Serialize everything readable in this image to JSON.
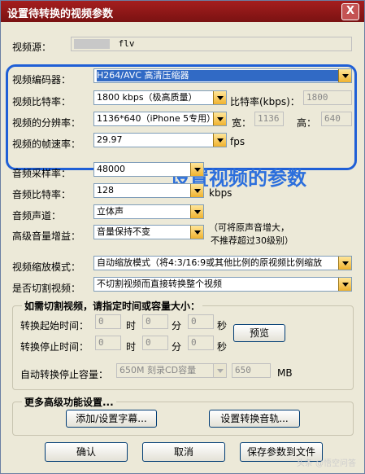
{
  "window": {
    "title": "设置待转换的视频参数",
    "close_label": "X"
  },
  "source": {
    "label": "视频源：",
    "value": "flv"
  },
  "video": {
    "encoder_label": "视频编码器：",
    "encoder_value": "H264/AVC 高清压缩器",
    "bitrate_label": "视频比特率：",
    "bitrate_value": "1800 kbps（极高质量）",
    "bitrate_kbps_label": "比特率(kbps)：",
    "bitrate_kbps_value": "1800",
    "resolution_label": "视频的分辨率：",
    "resolution_value": "1136*640（iPhone 5专用）",
    "width_label": "宽：",
    "width_value": "1136",
    "height_label": "高：",
    "height_value": "640",
    "framerate_label": "视频的帧速率：",
    "framerate_value": "29.97",
    "fps_label": "fps"
  },
  "overlay_text": "设置视频的参数",
  "audio": {
    "samplerate_label": "音频采样率：",
    "samplerate_value": "48000",
    "bitrate_label": "音频比特率：",
    "bitrate_value": "128",
    "kbps_label": "kbps",
    "channel_label": "音频声道：",
    "channel_value": "立体声",
    "gain_label": "高级音量增益：",
    "gain_value": "音量保持不变",
    "gain_note_1": "（可将原声音增大，",
    "gain_note_2": "不推荐超过30级别）"
  },
  "scale": {
    "label": "视频缩放模式：",
    "value": "自动缩放模式（将4:3/16:9或其他比例的原视频比例缩放"
  },
  "cut": {
    "label": "是否切割视频：",
    "value": "不切割视频而直接转换整个视频"
  },
  "cut_group": {
    "title": "如需切割视频，请指定时间或容量大小：",
    "start_label": "转换起始时间：",
    "stop_label": "转换停止时间：",
    "hour_unit": "时",
    "minute_unit": "分",
    "second_unit": "秒",
    "start_h": "0",
    "start_m": "0",
    "start_s": "0",
    "stop_h": "0",
    "stop_m": "0",
    "stop_s": "0",
    "preview_label": "预览",
    "auto_stop_label": "自动转换停止容量：",
    "auto_stop_value": "650M 刻录CD容量",
    "size_value": "650",
    "size_unit": "MB"
  },
  "advanced": {
    "title": "更多高级功能设置...",
    "subtitle_button": "添加/设置字幕...",
    "audio_track_button": "设置转换音轨..."
  },
  "footer": {
    "ok_label": "确认",
    "cancel_label": "取消",
    "save_label": "保存参数到文件"
  },
  "watermark": "头条 @悟空问答"
}
